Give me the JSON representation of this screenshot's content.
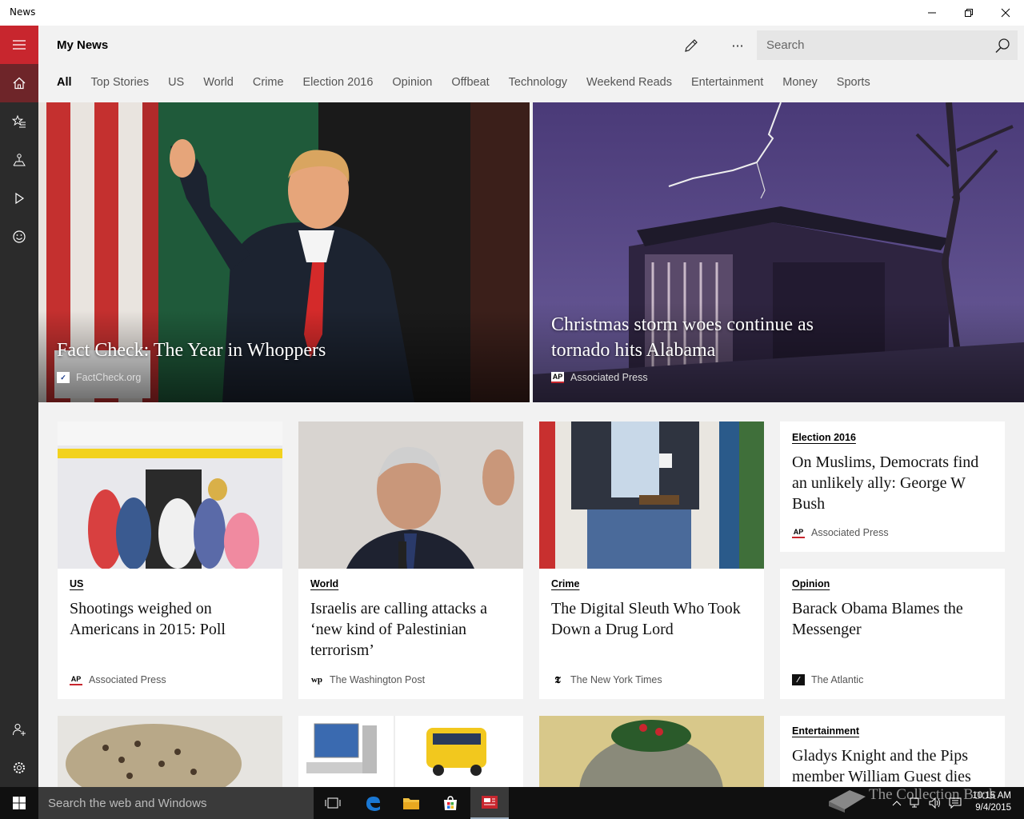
{
  "window": {
    "title": "News"
  },
  "header": {
    "title": "My News",
    "search_placeholder": "Search"
  },
  "tabs": [
    {
      "label": "All",
      "active": true
    },
    {
      "label": "Top Stories"
    },
    {
      "label": "US"
    },
    {
      "label": "World"
    },
    {
      "label": "Crime"
    },
    {
      "label": "Election 2016"
    },
    {
      "label": "Opinion"
    },
    {
      "label": "Offbeat"
    },
    {
      "label": "Technology"
    },
    {
      "label": "Weekend Reads"
    },
    {
      "label": "Entertainment"
    },
    {
      "label": "Money"
    },
    {
      "label": "Sports"
    }
  ],
  "sidebar": {
    "items": [
      {
        "icon": "home-icon",
        "active": true
      },
      {
        "icon": "interests-star-icon"
      },
      {
        "icon": "local-icon"
      },
      {
        "icon": "video-icon"
      },
      {
        "icon": "sports-smiley-icon"
      },
      {
        "icon": "add-person-icon"
      },
      {
        "icon": "settings-icon"
      }
    ]
  },
  "hero": [
    {
      "headline": "Fact Check: The Year in Whoppers",
      "source": "FactCheck.org"
    },
    {
      "headline": "Christmas storm woes continue as tornado hits Alabama",
      "source": "Associated Press"
    }
  ],
  "cards": [
    {
      "category": "US",
      "title": "Shootings weighed on Americans in 2015: Poll",
      "source": "Associated Press"
    },
    {
      "category": "World",
      "title": "Israelis are calling attacks a ‘new kind of Palestinian terrorism’",
      "source": "The Washington Post"
    },
    {
      "category": "Crime",
      "title": "The Digital Sleuth Who Took Down a Drug Lord",
      "source": "The New York Times"
    },
    {
      "category": "Election 2016",
      "title": "On Muslims, Democrats find an unlikely ally: George W Bush",
      "source": "Associated Press"
    },
    {
      "category": "Opinion",
      "title": "Barack Obama Blames the Messenger",
      "source": "The Atlantic"
    },
    {
      "category": "Entertainment",
      "title": "Gladys Knight and the Pips member William Guest dies"
    }
  ],
  "source_logos": {
    "ap": "AP",
    "wp": "wp",
    "nyt": "𝕿"
  },
  "taskbar": {
    "search_placeholder": "Search the web and Windows",
    "time": "10:15 AM",
    "date": "9/4/2015"
  },
  "watermark": "The Collection Book",
  "colors": {
    "accent": "#c8262e",
    "sidebar_bg": "#2b2b2b",
    "taskbar_bg": "#101010",
    "page_bg": "#f2f2f2"
  }
}
